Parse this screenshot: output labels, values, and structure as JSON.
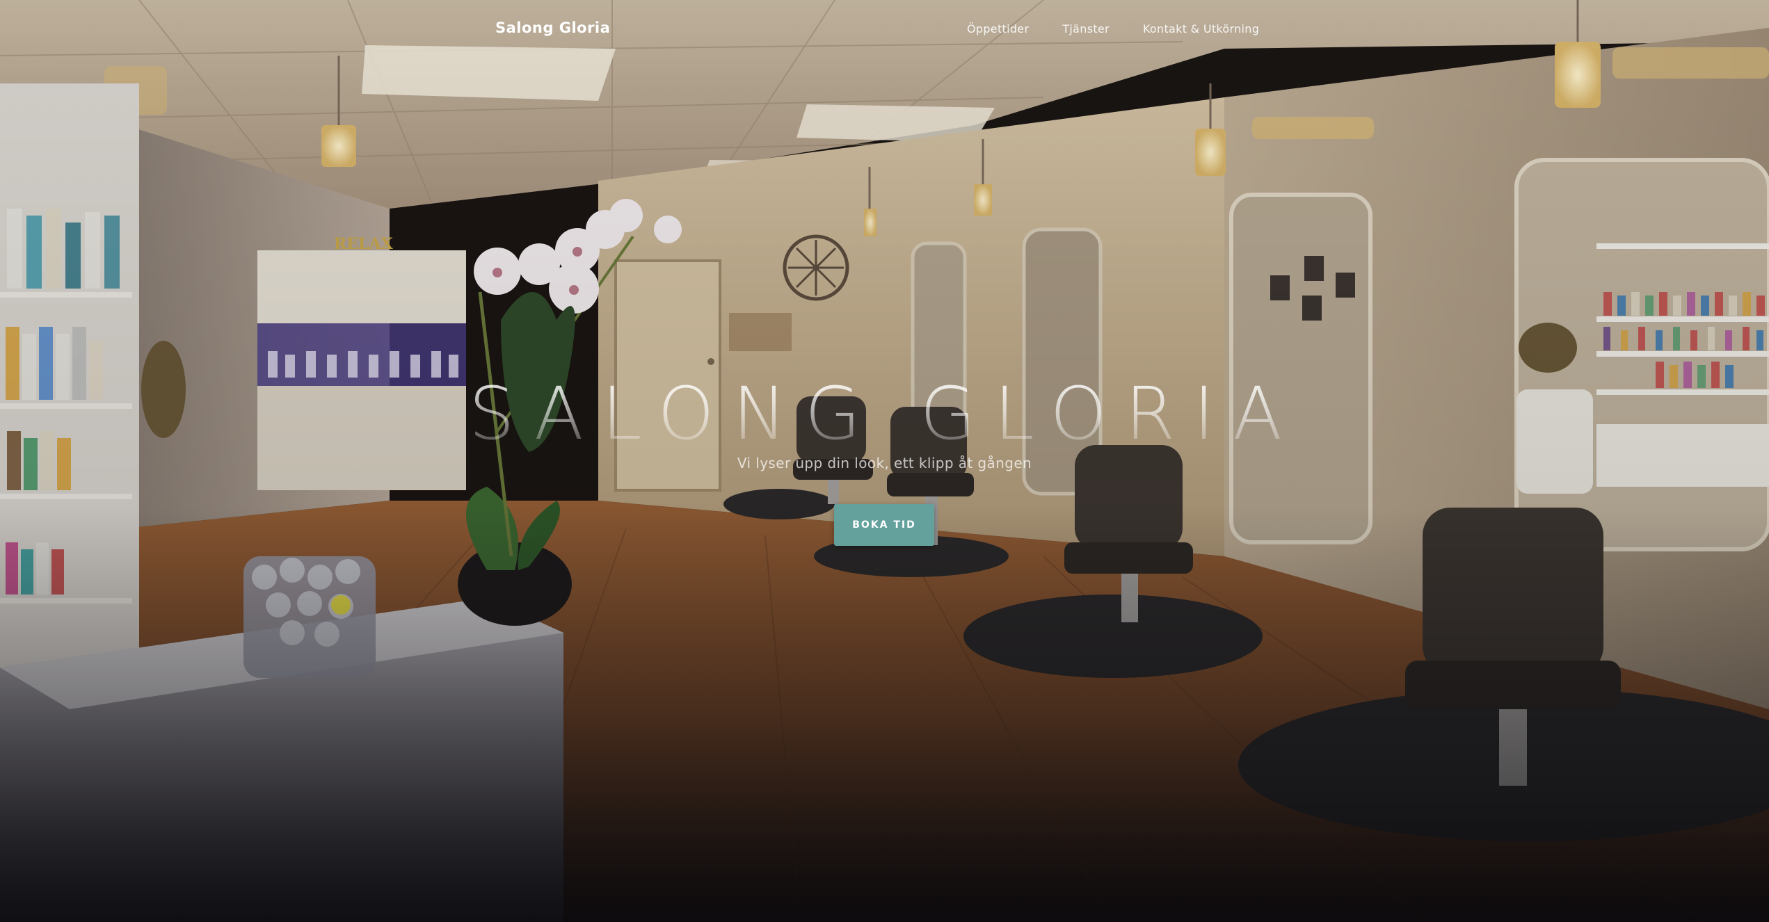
{
  "navbar": {
    "brand": "Salong Gloria",
    "links": [
      {
        "label": "Öppettider"
      },
      {
        "label": "Tjänster"
      },
      {
        "label": "Kontakt & Utkörning"
      }
    ]
  },
  "hero": {
    "title": "SALONG GLORIA",
    "subtitle": "Vi lyser upp din look, ett klipp åt gången",
    "cta_label": "BOKA TID"
  },
  "background": {
    "theme_colors": {
      "floor": "#8a5530",
      "wall": "#c9b79a",
      "ceiling": "#b9ab97",
      "accent": "#64a19d"
    },
    "wall_sign": "RELAX"
  }
}
